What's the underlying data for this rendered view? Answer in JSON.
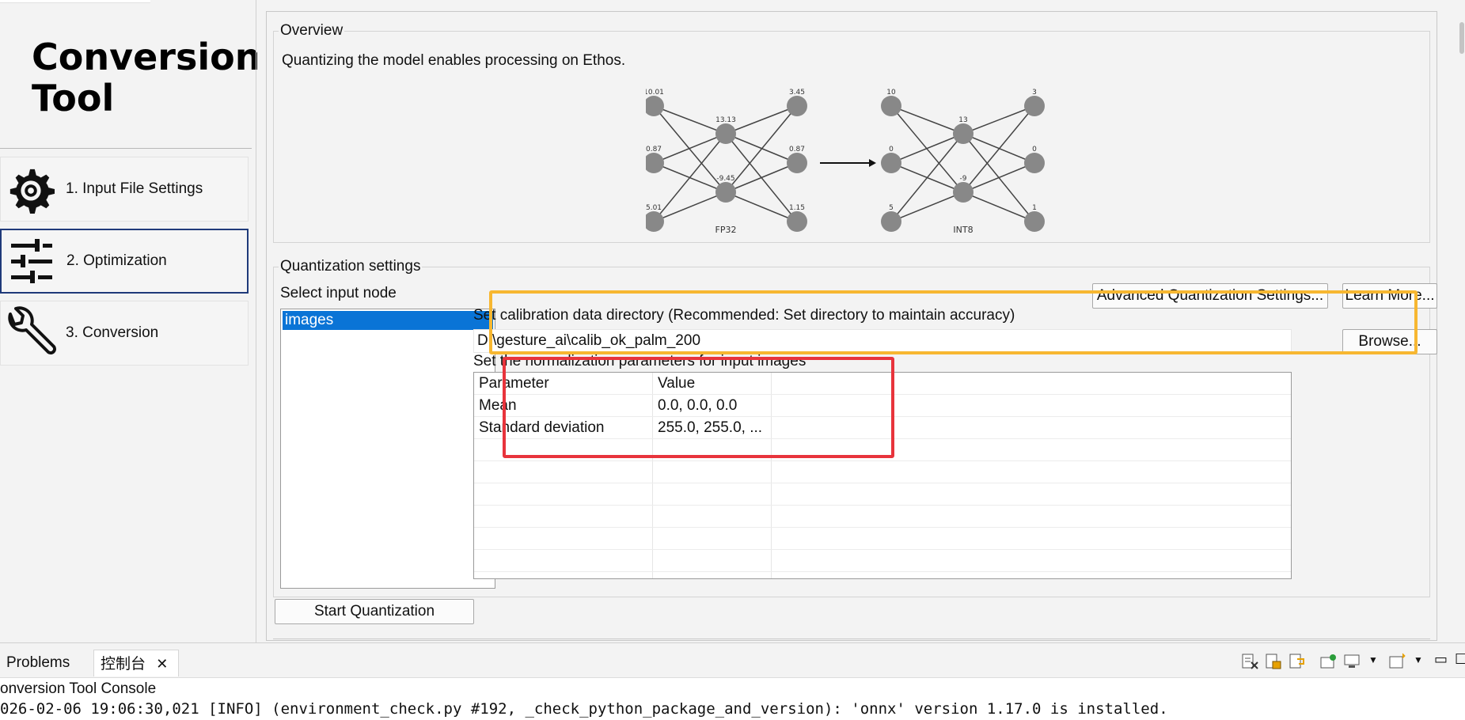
{
  "app": {
    "title": "Conversion Tool"
  },
  "nav": {
    "items": [
      {
        "label": "1. Input File Settings",
        "icon": "gear-icon"
      },
      {
        "label": "2. Optimization",
        "icon": "sliders-icon"
      },
      {
        "label": "3. Conversion",
        "icon": "wrench-icon"
      }
    ],
    "active_index": 1
  },
  "overview": {
    "group_title": "Overview",
    "description": "Quantizing the model enables processing on Ethos.",
    "diagram": {
      "fp32": {
        "caption": "FP32",
        "left": [
          "10.01",
          "0.87",
          "5.01"
        ],
        "middle": [
          "13.13",
          "-9.45"
        ],
        "right": [
          "3.45",
          "0.87",
          "1.15"
        ]
      },
      "int8": {
        "caption": "INT8",
        "left": [
          "10",
          "0",
          "5"
        ],
        "middle": [
          "13",
          "-9"
        ],
        "right": [
          "3",
          "0",
          "1"
        ]
      }
    }
  },
  "quantization": {
    "group_title": "Quantization settings",
    "select_input_node_label": "Select input node",
    "input_nodes": [
      "images"
    ],
    "advanced_button": "Advanced Quantization Settings...",
    "learn_more_button": "Learn More...",
    "calibration_label": "Set calibration data directory (Recommended: Set directory to maintain accuracy)",
    "calibration_path": "D:\\gesture_ai\\calib_ok_palm_200",
    "browse_button": "Browse...",
    "normalization_label": "Set the normalization parameters for input images",
    "table": {
      "headers": [
        "Parameter",
        "Value"
      ],
      "rows": [
        {
          "parameter": "Mean",
          "value": "0.0, 0.0, 0.0"
        },
        {
          "parameter": "Standard deviation",
          "value": "255.0, 255.0, ..."
        }
      ]
    },
    "start_button": "Start Quantization"
  },
  "console": {
    "tabs": [
      "Problems",
      "控制台"
    ],
    "active_tab": 1,
    "title": "onversion Tool Console",
    "lines": [
      "026-02-06 19:06:30,021 [INFO] (environment_check.py #192, _check_python_package_and_version): 'onnx' version 1.17.0 is installed."
    ]
  },
  "colors": {
    "selection": "#0a74d6",
    "highlight_yellow": "#f7b731",
    "highlight_red": "#e8343c",
    "active_nav_border": "#1f3a7a"
  }
}
